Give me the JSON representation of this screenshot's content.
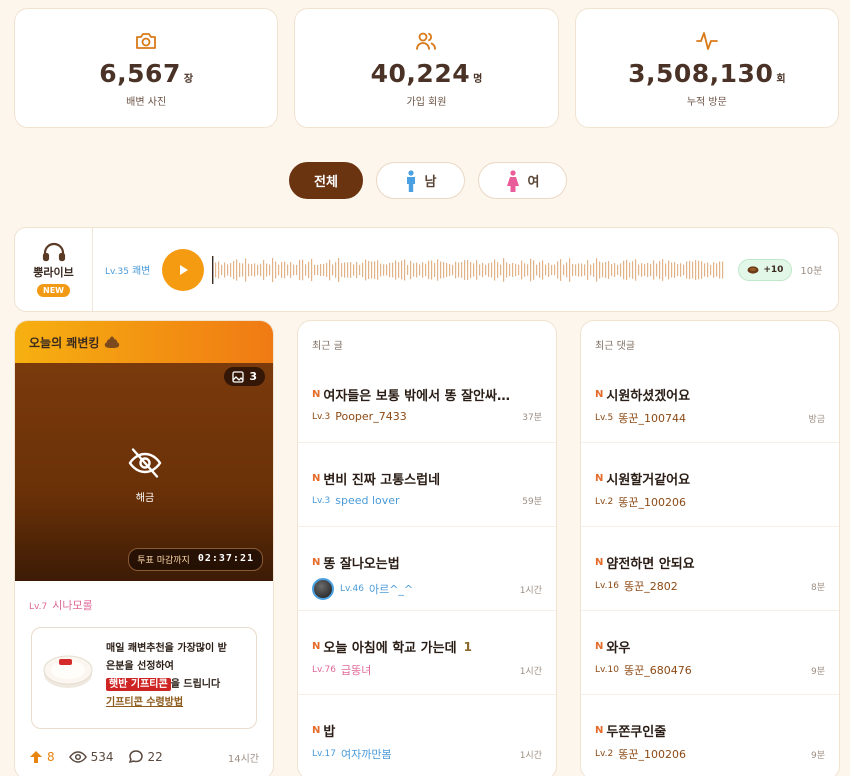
{
  "stats": [
    {
      "icon": "camera-icon",
      "value": "6,567",
      "unit": "장",
      "label": "배변 사진"
    },
    {
      "icon": "users-icon",
      "value": "40,224",
      "unit": "명",
      "label": "가입 회원"
    },
    {
      "icon": "activity-icon",
      "value": "3,508,130",
      "unit": "회",
      "label": "누적 방문"
    }
  ],
  "filters": {
    "all": "전체",
    "male": "남",
    "female": "여"
  },
  "live": {
    "title": "뿡라이브",
    "badge": "NEW",
    "user_level": "Lv.35",
    "user_name": "쾌변",
    "reward": "+10",
    "time": "10분"
  },
  "king": {
    "title": "오늘의 쾌변킹",
    "image_count": "3",
    "blur_label": "해금",
    "deadline_label": "투표 마감까지",
    "deadline_time": "02:37:21",
    "user_level": "Lv.7",
    "user_name": "시나모롤",
    "promo_line1": "매일 쾌변추천을 가장많이 받",
    "promo_line2": "은분을 선정하여",
    "promo_highlight": "햇반 기프티콘",
    "promo_after": "을 드립니다",
    "promo_link": "기프티콘 수령방법",
    "upvotes": "8",
    "views": "534",
    "comments": "22",
    "time": "14시간"
  },
  "recent_posts": {
    "heading": "최근 글",
    "items": [
      {
        "title": "여자들은 보통 밖에서 똥 잘안싸…",
        "count": "",
        "level": "Lv.3",
        "user": "Pooper_7433",
        "time": "37분",
        "color": "brown",
        "avatar": false
      },
      {
        "title": "변비 진짜 고통스럽네",
        "count": "",
        "level": "Lv.3",
        "user": "speed lover",
        "time": "59분",
        "color": "blue",
        "avatar": false
      },
      {
        "title": "똥 잘나오는법",
        "count": "",
        "level": "Lv.46",
        "user": "아르^_^",
        "time": "1시간",
        "color": "blue",
        "avatar": true
      },
      {
        "title": "오늘 아침에 학교 가는데",
        "count": "1",
        "level": "Lv.76",
        "user": "급똥녀",
        "time": "1시간",
        "color": "pink",
        "avatar": false
      },
      {
        "title": "밥",
        "count": "",
        "level": "Lv.17",
        "user": "여자까만봄",
        "time": "1시간",
        "color": "blue",
        "avatar": false
      }
    ]
  },
  "recent_comments": {
    "heading": "최근 댓글",
    "items": [
      {
        "title": "시원하셨겠어요",
        "level": "Lv.5",
        "user": "똥꾼_100744",
        "time": "방금",
        "color": "brown"
      },
      {
        "title": "시원할거같어요",
        "level": "Lv.2",
        "user": "똥꾼_100206",
        "time": "",
        "color": "brown"
      },
      {
        "title": "얌전하면 안되요",
        "level": "Lv.16",
        "user": "똥꾼_2802",
        "time": "8분",
        "color": "brown"
      },
      {
        "title": "와우",
        "level": "Lv.10",
        "user": "똥꾼_680476",
        "time": "9분",
        "color": "brown"
      },
      {
        "title": "두쫀쿠인줄",
        "level": "Lv.2",
        "user": "똥꾼_100206",
        "time": "9분",
        "color": "brown"
      }
    ]
  },
  "new_marker": "N",
  "colors": {
    "accent": "#f59b12",
    "brand_brown": "#6b3410",
    "male": "#4aa0e0",
    "female": "#e85c9a"
  }
}
